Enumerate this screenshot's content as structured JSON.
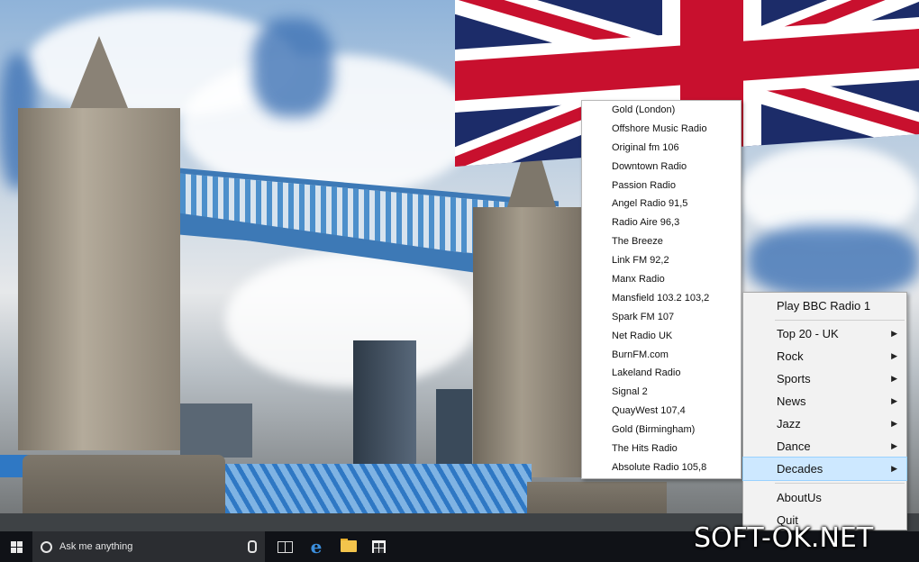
{
  "station_submenu": {
    "items": [
      "Gold (London)",
      "Offshore Music Radio",
      "Original fm 106",
      "Downtown Radio",
      "Passion Radio",
      "Angel Radio 91,5",
      "Radio Aire 96,3",
      "The Breeze",
      "Link FM 92,2",
      "Manx Radio",
      "Mansfield 103.2 103,2",
      "Spark FM 107",
      "Net Radio UK",
      "BurnFM.com",
      "Lakeland Radio",
      "Signal 2",
      "QuayWest 107,4",
      "Gold (Birmingham)",
      "The Hits Radio",
      "Absolute Radio 105,8"
    ]
  },
  "context_menu": {
    "play": "Play BBC Radio 1",
    "top20": "Top 20 - UK",
    "rock": "Rock",
    "sports": "Sports",
    "news": "News",
    "jazz": "Jazz",
    "dance": "Dance",
    "decades": "Decades",
    "about": "AboutUs",
    "quit": "Quit",
    "selected": "Decades",
    "highlight_color": "#cde8ff"
  },
  "taskbar": {
    "search_placeholder": "Ask me anything",
    "icons": [
      "windows-start-icon",
      "search-icon",
      "microphone-icon",
      "task-view-icon",
      "edge-browser-icon",
      "file-explorer-icon",
      "store-icon"
    ]
  },
  "watermark": "SOFT-OK.NET",
  "colors": {
    "taskbar_bg": "#101217",
    "menu_bg": "#f2f2f2",
    "submenu_bg": "#ffffff"
  }
}
